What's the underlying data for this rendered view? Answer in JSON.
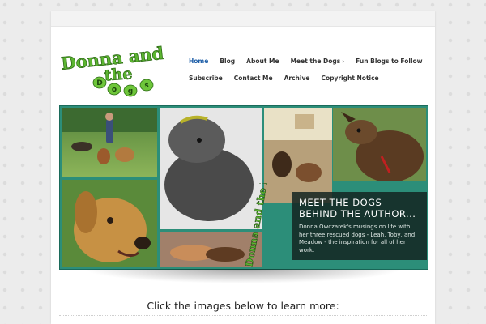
{
  "site": {
    "logo_alt": "Donna and the Dogs",
    "logo_line1": "Donna and",
    "logo_line2": "the",
    "logo_line3": "Dogs"
  },
  "nav": {
    "row1": [
      {
        "label": "Home",
        "active": true
      },
      {
        "label": "Blog"
      },
      {
        "label": "About Me"
      },
      {
        "label": "Meet the Dogs",
        "has_submenu": true
      },
      {
        "label": "Fun Blogs to Follow"
      }
    ],
    "row2": [
      {
        "label": "Subscribe"
      },
      {
        "label": "Contact Me"
      },
      {
        "label": "Archive"
      },
      {
        "label": "Copyright Notice"
      }
    ],
    "submenu_chevron": "›"
  },
  "banner": {
    "title": "MEET THE DOGS BEHIND THE AUTHOR...",
    "text": "Donna Owczarek's musings on life with her three rescued dogs - Leah, Toby, and Meadow - the inspiration for all of her work.",
    "overlay_logo": "Donna and the Dogs"
  },
  "content": {
    "learn_more": "Click the images below to learn more:"
  },
  "colors": {
    "nav_active": "#1f5fa8",
    "banner_teal": "#2c8e79",
    "logo_green": "#5cb531"
  }
}
